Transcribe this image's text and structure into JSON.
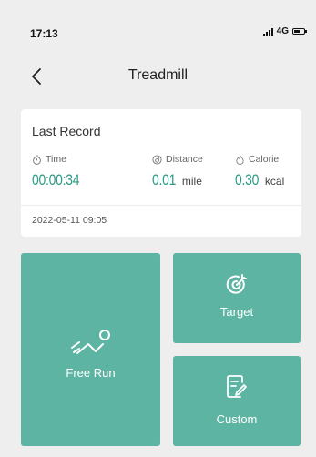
{
  "status_bar": {
    "time": "17:13",
    "network": "4G"
  },
  "nav": {
    "title": "Treadmill",
    "back_icon": "chevron-left-icon"
  },
  "last_record": {
    "title": "Last Record",
    "metrics": [
      {
        "label": "Time",
        "icon": "stopwatch-icon",
        "value": "00:00:34",
        "unit": ""
      },
      {
        "label": "Distance",
        "icon": "distance-icon",
        "value": "0.01",
        "unit": "mile"
      },
      {
        "label": "Calorie",
        "icon": "flame-icon",
        "value": "0.30",
        "unit": "kcal"
      }
    ],
    "date": "2022-05-11 09:05"
  },
  "modes": {
    "free_run": {
      "label": "Free Run",
      "icon": "running-icon"
    },
    "target": {
      "label": "Target",
      "icon": "target-icon"
    },
    "custom": {
      "label": "Custom",
      "icon": "edit-document-icon"
    }
  },
  "colors": {
    "accent": "#2a9a86",
    "tile": "#5eb4a3",
    "background": "#eeeeee"
  }
}
